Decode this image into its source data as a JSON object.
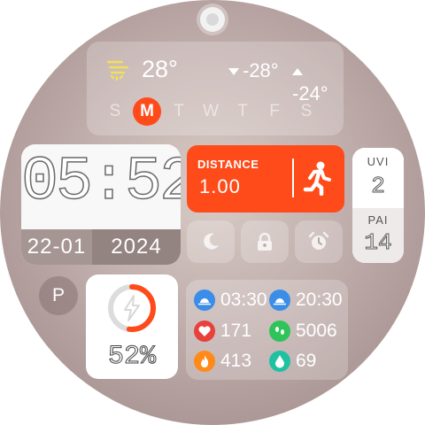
{
  "weather": {
    "temperature": "28°",
    "low": "-28°",
    "high": "-24°",
    "icon": "sun-haze-icon",
    "icon_color": "#f2e05a"
  },
  "week": {
    "days": [
      "S",
      "M",
      "T",
      "W",
      "T",
      "F",
      "S"
    ],
    "active_index": 1
  },
  "time": {
    "value": "05:52",
    "date_day_month": "22-01",
    "date_year": "2024"
  },
  "distance": {
    "label": "DISTANCE",
    "value": "1.00",
    "icon": "running-person-icon",
    "color": "#ff4b19"
  },
  "uvi": {
    "label": "UVI",
    "value": "2"
  },
  "pai": {
    "label": "PAI",
    "value": "14"
  },
  "quick_actions": [
    {
      "name": "do-not-disturb",
      "icon": "moon-icon"
    },
    {
      "name": "lock",
      "icon": "lock-icon"
    },
    {
      "name": "alarm",
      "icon": "alarm-clock-icon"
    }
  ],
  "p_button": {
    "label": "P"
  },
  "battery": {
    "percent_text": "52%",
    "percent": 52,
    "icon": "lightning-icon",
    "color": "#ff4b19"
  },
  "stats": {
    "sunrise": {
      "value": "03:30",
      "icon": "sunrise-icon",
      "color": "#3a8de8"
    },
    "sunset": {
      "value": "20:30",
      "icon": "sunset-icon",
      "color": "#3a8de8"
    },
    "heart_rate": {
      "value": "171",
      "icon": "heart-icon",
      "color": "#e8403a"
    },
    "steps": {
      "value": "5006",
      "icon": "footsteps-icon",
      "color": "#2ec45a"
    },
    "calories": {
      "value": "413",
      "icon": "flame-icon",
      "color": "#ff8a1a"
    },
    "water": {
      "value": "69",
      "icon": "water-drop-icon",
      "color": "#1fc2a0"
    }
  }
}
